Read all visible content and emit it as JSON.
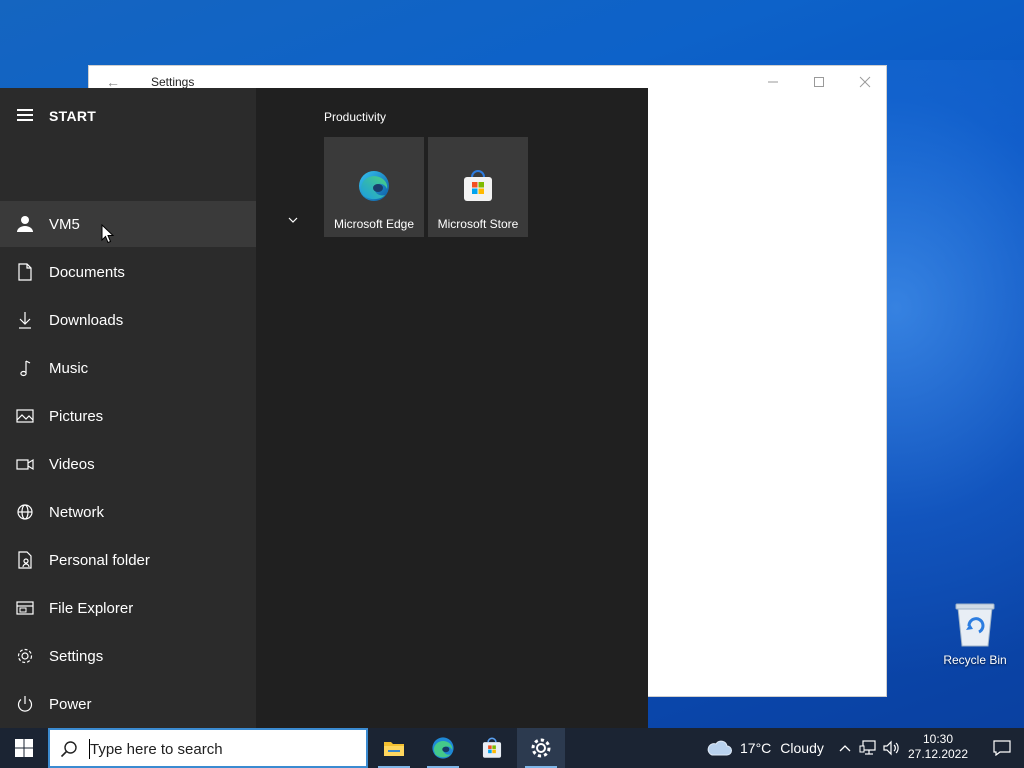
{
  "settings_window": {
    "title": "Settings"
  },
  "start_menu": {
    "header": "START",
    "nav": [
      {
        "label": "VM5",
        "icon": "user-icon",
        "active": true
      },
      {
        "label": "Documents",
        "icon": "document-icon"
      },
      {
        "label": "Downloads",
        "icon": "download-icon"
      },
      {
        "label": "Music",
        "icon": "music-icon"
      },
      {
        "label": "Pictures",
        "icon": "pictures-icon"
      },
      {
        "label": "Videos",
        "icon": "videos-icon"
      },
      {
        "label": "Network",
        "icon": "network-icon"
      },
      {
        "label": "Personal folder",
        "icon": "personal-folder-icon"
      },
      {
        "label": "File Explorer",
        "icon": "file-explorer-icon"
      },
      {
        "label": "Settings",
        "icon": "gear-icon"
      },
      {
        "label": "Power",
        "icon": "power-icon"
      }
    ],
    "group_title": "Productivity",
    "tiles": [
      {
        "label": "Microsoft Edge",
        "icon": "edge-icon"
      },
      {
        "label": "Microsoft Store",
        "icon": "store-icon"
      }
    ]
  },
  "desktop": {
    "recycle_bin_label": "Recycle Bin"
  },
  "taskbar": {
    "search_placeholder": "Type here to search",
    "weather_temp": "17°C",
    "weather_text": "Cloudy",
    "time": "10:30",
    "date": "27.12.2022",
    "apps": [
      "file-explorer-icon",
      "edge-icon",
      "store-icon",
      "gear-icon"
    ]
  },
  "colors": {
    "accent": "#3b8bd1",
    "taskbar_bg": "#1b2433",
    "start_nav_bg": "#2b2b2b",
    "start_tiles_bg": "#202020"
  }
}
